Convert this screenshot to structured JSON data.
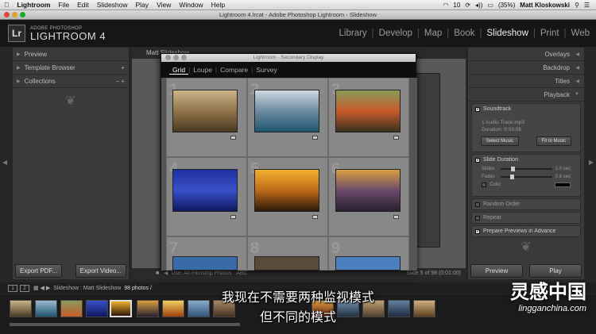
{
  "menubar": {
    "items": [
      "Lightroom",
      "File",
      "Edit",
      "Slideshow",
      "Play",
      "View",
      "Window",
      "Help"
    ],
    "battery": "(35%)",
    "user": "Matt Kloskowski",
    "counter": "10"
  },
  "window": {
    "title": "Lightroom 4.lrcat - Adobe Photoshop Lightroom - Slideshow"
  },
  "identity": {
    "logo": "Lr",
    "sub": "ADOBE PHOTOSHOP",
    "name": "LIGHTROOM 4"
  },
  "modules": [
    "Library",
    "Develop",
    "Map",
    "Book",
    "Slideshow",
    "Print",
    "Web"
  ],
  "active_module": "Slideshow",
  "left_panel": {
    "sections": [
      {
        "label": "Preview",
        "action": ""
      },
      {
        "label": "Template Browser",
        "action": "+"
      },
      {
        "label": "Collections",
        "action": "− +"
      }
    ],
    "export_pdf": "Export PDF...",
    "export_video": "Export Video..."
  },
  "center": {
    "title": "Matt Slideshow",
    "toolbar_text": "Use:  All Filmstrip Photos",
    "toolbar_abc": "ABC",
    "slide_count": "Slide 5 of 98 (0:01:00)"
  },
  "secondary": {
    "title": "Lightroom - Secondary Display",
    "tabs": [
      "Grid",
      "Loupe",
      "Compare",
      "Survey"
    ],
    "active_tab": "Grid",
    "cell_numbers": [
      "1",
      "2",
      "3",
      "4",
      "5",
      "6",
      "7",
      "8",
      "9"
    ]
  },
  "right_panel": {
    "sections": [
      "Overlays",
      "Backdrop",
      "Titles",
      "Playback"
    ],
    "soundtrack": "Soundtrack",
    "audio_file": "1 Audio Track.mp3",
    "duration": "Duration: 0:03:08",
    "select_music": "Select Music",
    "fit_to_music": "Fit to Music",
    "slide_duration": "Slide Duration",
    "slides_label": "Slides",
    "slides_value": "1.0",
    "slides_unit": "sec",
    "slides_level": 0.2,
    "fades_label": "Fades",
    "fades_value": "0.9",
    "fades_unit": "sec",
    "fades_level": 0.18,
    "color_label": "Color",
    "random_order": "Random Order",
    "repeat": "Repeat",
    "prepare_previews": "Prepare Previews in Advance",
    "preview_button": "Preview",
    "play_button": "Play"
  },
  "filmstrip": {
    "monitor1": "1",
    "monitor2": "2",
    "path": "Slideshow : Matt Slideshow",
    "count": "98 photos /"
  },
  "subtitles": [
    "我现在不需要两种监视模式",
    "但不同的模式"
  ],
  "watermark": {
    "name": "灵感中国",
    "url": "lingganchina.com"
  },
  "colors": {
    "accent": "#e8e8e8",
    "panel": "#3a3a3a",
    "background": "#262626"
  }
}
